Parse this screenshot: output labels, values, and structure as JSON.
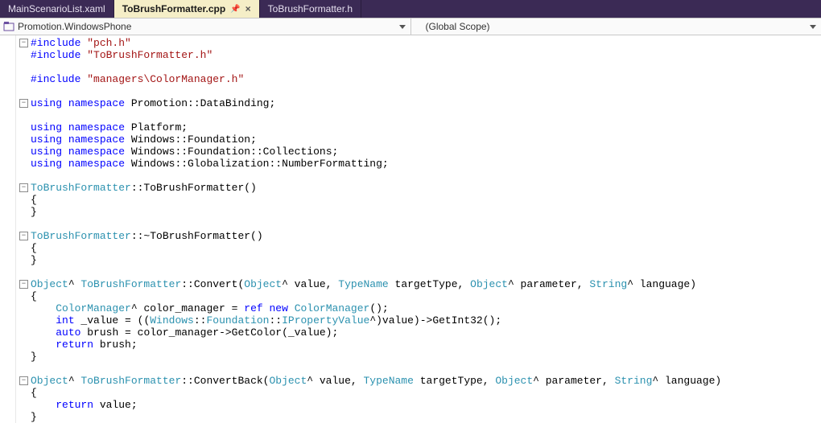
{
  "tabs": [
    {
      "label": "MainScenarioList.xaml",
      "active": false
    },
    {
      "label": "ToBrushFormatter.cpp",
      "active": true
    },
    {
      "label": "ToBrushFormatter.h",
      "active": false
    }
  ],
  "nav": {
    "project": "Promotion.WindowsPhone",
    "scope": "(Global Scope)"
  },
  "code": {
    "lines": [
      {
        "fold": "-",
        "tokens": [
          [
            "kw",
            "#include "
          ],
          [
            "str",
            "\"pch.h\""
          ]
        ]
      },
      {
        "fold": "",
        "tokens": [
          [
            "kw",
            "#include "
          ],
          [
            "str",
            "\"ToBrushFormatter.h\""
          ]
        ]
      },
      {
        "fold": "",
        "tokens": [
          [
            "",
            ""
          ]
        ]
      },
      {
        "fold": "",
        "tokens": [
          [
            "kw",
            "#include "
          ],
          [
            "str",
            "\"managers\\ColorManager.h\""
          ]
        ]
      },
      {
        "fold": "",
        "tokens": [
          [
            "",
            ""
          ]
        ]
      },
      {
        "fold": "-",
        "tokens": [
          [
            "kw",
            "using"
          ],
          [
            "",
            " "
          ],
          [
            "kw",
            "namespace"
          ],
          [
            "",
            " Promotion::DataBinding;"
          ]
        ]
      },
      {
        "fold": "",
        "tokens": [
          [
            "",
            ""
          ]
        ]
      },
      {
        "fold": "",
        "tokens": [
          [
            "kw",
            "using"
          ],
          [
            "",
            " "
          ],
          [
            "kw",
            "namespace"
          ],
          [
            "",
            " Platform;"
          ]
        ]
      },
      {
        "fold": "",
        "tokens": [
          [
            "kw",
            "using"
          ],
          [
            "",
            " "
          ],
          [
            "kw",
            "namespace"
          ],
          [
            "",
            " Windows::Foundation;"
          ]
        ]
      },
      {
        "fold": "",
        "tokens": [
          [
            "kw",
            "using"
          ],
          [
            "",
            " "
          ],
          [
            "kw",
            "namespace"
          ],
          [
            "",
            " Windows::Foundation::Collections;"
          ]
        ]
      },
      {
        "fold": "",
        "tokens": [
          [
            "kw",
            "using"
          ],
          [
            "",
            " "
          ],
          [
            "kw",
            "namespace"
          ],
          [
            "",
            " Windows::Globalization::NumberFormatting;"
          ]
        ]
      },
      {
        "fold": "",
        "tokens": [
          [
            "",
            ""
          ]
        ]
      },
      {
        "fold": "-",
        "tokens": [
          [
            "typ",
            "ToBrushFormatter"
          ],
          [
            "",
            "::ToBrushFormatter()"
          ]
        ]
      },
      {
        "fold": "",
        "tokens": [
          [
            "",
            "{"
          ]
        ]
      },
      {
        "fold": "",
        "tokens": [
          [
            "",
            "}"
          ]
        ]
      },
      {
        "fold": "",
        "tokens": [
          [
            "",
            ""
          ]
        ]
      },
      {
        "fold": "-",
        "tokens": [
          [
            "typ",
            "ToBrushFormatter"
          ],
          [
            "",
            "::~ToBrushFormatter()"
          ]
        ]
      },
      {
        "fold": "",
        "tokens": [
          [
            "",
            "{"
          ]
        ]
      },
      {
        "fold": "",
        "tokens": [
          [
            "",
            "}"
          ]
        ]
      },
      {
        "fold": "",
        "tokens": [
          [
            "",
            ""
          ]
        ]
      },
      {
        "fold": "-",
        "tokens": [
          [
            "typ",
            "Object"
          ],
          [
            "",
            "^ "
          ],
          [
            "typ",
            "ToBrushFormatter"
          ],
          [
            "",
            "::Convert("
          ],
          [
            "typ",
            "Object"
          ],
          [
            "",
            "^ value, "
          ],
          [
            "typ",
            "TypeName"
          ],
          [
            "",
            " targetType, "
          ],
          [
            "typ",
            "Object"
          ],
          [
            "",
            "^ parameter, "
          ],
          [
            "typ",
            "String"
          ],
          [
            "",
            "^ language)"
          ]
        ]
      },
      {
        "fold": "",
        "tokens": [
          [
            "",
            "{"
          ]
        ]
      },
      {
        "fold": "",
        "tokens": [
          [
            "",
            "    "
          ],
          [
            "typ",
            "ColorManager"
          ],
          [
            "",
            "^ color_manager = "
          ],
          [
            "kw",
            "ref new"
          ],
          [
            "",
            " "
          ],
          [
            "typ",
            "ColorManager"
          ],
          [
            "",
            "();"
          ]
        ]
      },
      {
        "fold": "",
        "tokens": [
          [
            "",
            "    "
          ],
          [
            "kw",
            "int"
          ],
          [
            "",
            " _value = (("
          ],
          [
            "typ",
            "Windows"
          ],
          [
            "",
            "::"
          ],
          [
            "typ",
            "Foundation"
          ],
          [
            "",
            "::"
          ],
          [
            "typ",
            "IPropertyValue"
          ],
          [
            "",
            "^)value)->GetInt32();"
          ]
        ]
      },
      {
        "fold": "",
        "tokens": [
          [
            "",
            "    "
          ],
          [
            "kw",
            "auto"
          ],
          [
            "",
            " brush = color_manager->GetColor(_value);"
          ]
        ]
      },
      {
        "fold": "",
        "tokens": [
          [
            "",
            "    "
          ],
          [
            "kw",
            "return"
          ],
          [
            "",
            " brush;"
          ]
        ]
      },
      {
        "fold": "",
        "tokens": [
          [
            "",
            "}"
          ]
        ]
      },
      {
        "fold": "",
        "tokens": [
          [
            "",
            ""
          ]
        ]
      },
      {
        "fold": "-",
        "tokens": [
          [
            "typ",
            "Object"
          ],
          [
            "",
            "^ "
          ],
          [
            "typ",
            "ToBrushFormatter"
          ],
          [
            "",
            "::ConvertBack("
          ],
          [
            "typ",
            "Object"
          ],
          [
            "",
            "^ value, "
          ],
          [
            "typ",
            "TypeName"
          ],
          [
            "",
            " targetType, "
          ],
          [
            "typ",
            "Object"
          ],
          [
            "",
            "^ parameter, "
          ],
          [
            "typ",
            "String"
          ],
          [
            "",
            "^ language)"
          ]
        ]
      },
      {
        "fold": "",
        "tokens": [
          [
            "",
            "{"
          ]
        ]
      },
      {
        "fold": "",
        "tokens": [
          [
            "",
            "    "
          ],
          [
            "kw",
            "return"
          ],
          [
            "",
            " value;"
          ]
        ]
      },
      {
        "fold": "",
        "tokens": [
          [
            "",
            "}"
          ]
        ]
      }
    ]
  }
}
